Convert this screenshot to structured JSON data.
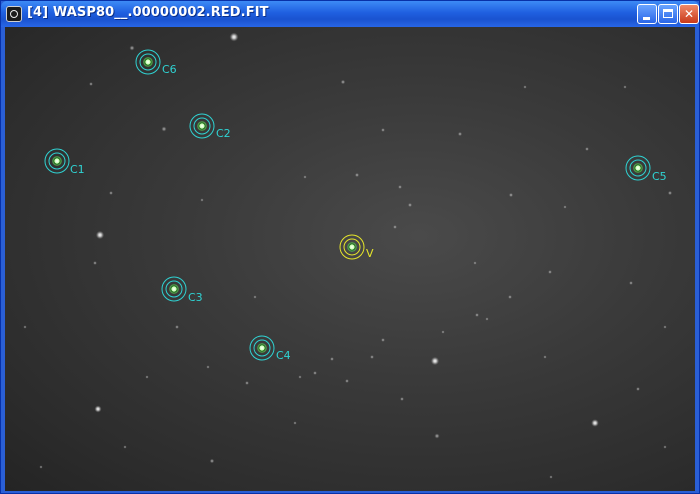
{
  "window": {
    "title": "[4] WASP80__.00000002.RED.FIT",
    "controls": [
      "minimize",
      "maximize",
      "close"
    ]
  },
  "image": {
    "colors": {
      "comparison": "#2fd3d3",
      "target": "#e6e62a",
      "star_core": "#c8ffb0"
    },
    "apertures": [
      {
        "label": "C6",
        "kind": "comparison"
      },
      {
        "label": "C2",
        "kind": "comparison"
      },
      {
        "label": "C1",
        "kind": "comparison"
      },
      {
        "label": "C5",
        "kind": "comparison"
      },
      {
        "label": "V",
        "kind": "target"
      },
      {
        "label": "C3",
        "kind": "comparison"
      },
      {
        "label": "C4",
        "kind": "comparison"
      }
    ]
  }
}
